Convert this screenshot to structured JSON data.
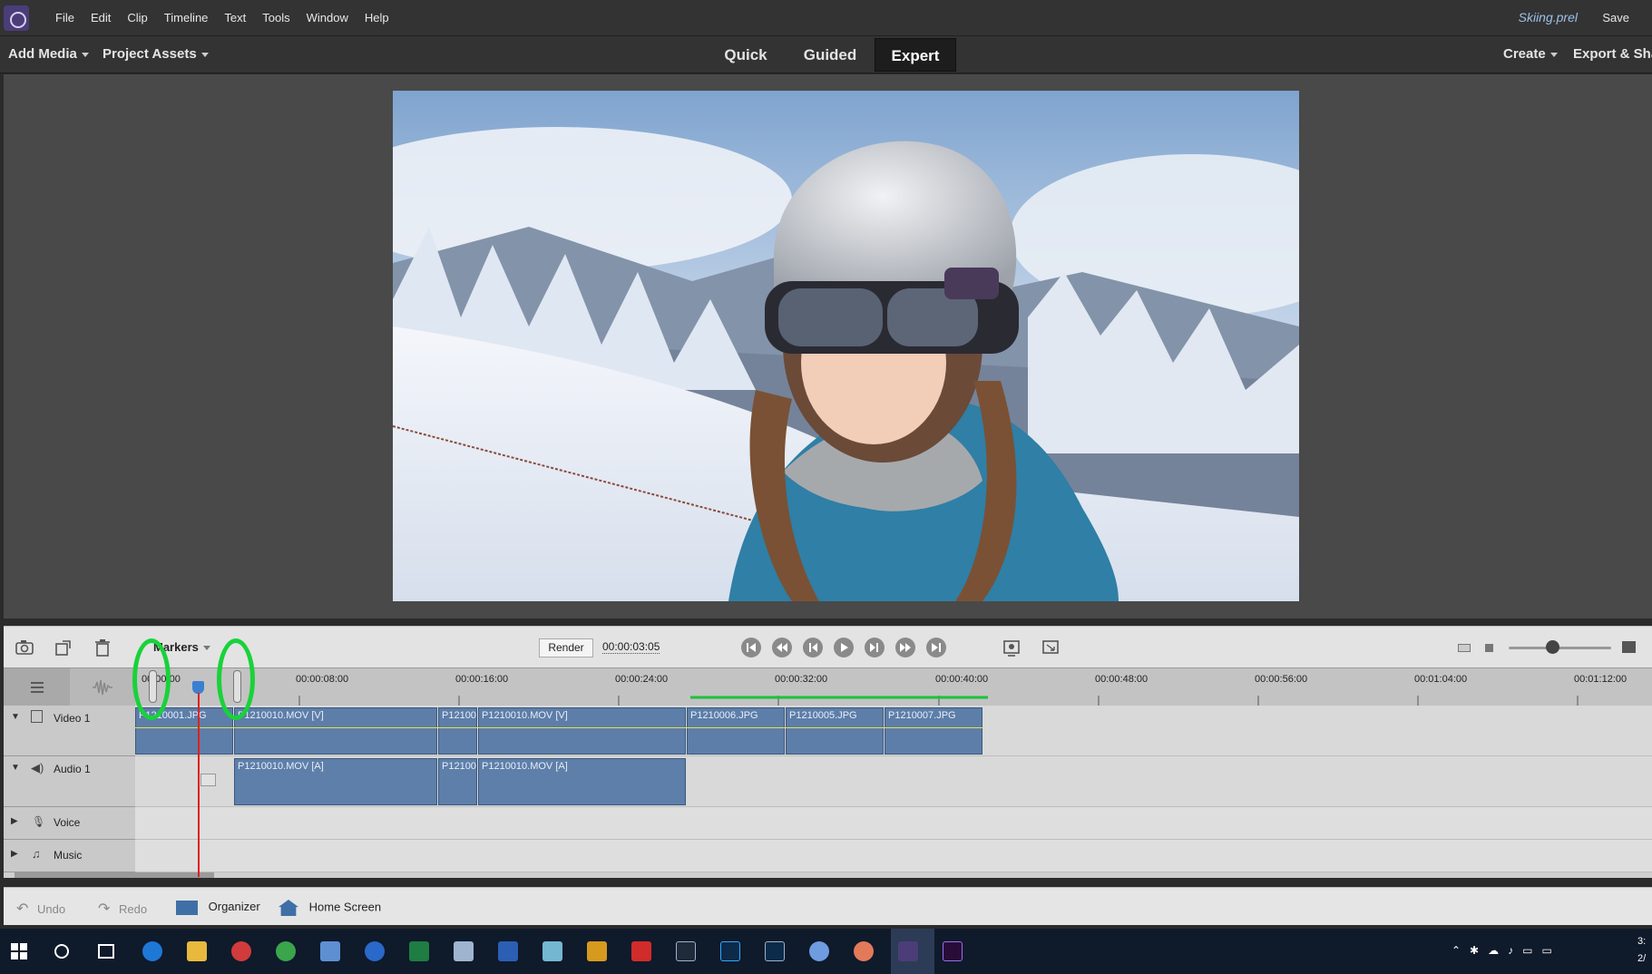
{
  "menubar": {
    "items": [
      "File",
      "Edit",
      "Clip",
      "Timeline",
      "Text",
      "Tools",
      "Window",
      "Help"
    ],
    "project_name": "Skiing.prel",
    "save_label": "Save"
  },
  "modebar": {
    "add_media": "Add Media",
    "project_assets": "Project Assets",
    "tabs": [
      "Quick",
      "Guided",
      "Expert"
    ],
    "active_tab": "Expert",
    "create": "Create",
    "export": "Export & Sha"
  },
  "transport": {
    "markers_label": "Markers",
    "render_label": "Render",
    "timecode": "00:00:03:05"
  },
  "ruler": {
    "start_time": "00:00:00",
    "ticks": [
      "00:00:08:00",
      "00:00:16:00",
      "00:00:24:00",
      "00:00:32:00",
      "00:00:40:00",
      "00:00:48:00",
      "00:00:56:00",
      "00:01:04:00",
      "00:01:12:00"
    ]
  },
  "tracks": {
    "video1": "Video 1",
    "audio1": "Audio 1",
    "voice": "Voice",
    "music": "Music",
    "video_clips": [
      "P1210001.JPG",
      "P1210010.MOV [V]",
      "P12100",
      "P1210010.MOV [V]",
      "P1210006.JPG",
      "P1210005.JPG",
      "P1210007.JPG"
    ],
    "audio_clips": [
      "P1210010.MOV [A]",
      "P12100",
      "P1210010.MOV [A]"
    ]
  },
  "bottombar": {
    "undo": "Undo",
    "redo": "Redo",
    "organizer": "Organizer",
    "home_screen": "Home Screen"
  },
  "taskbar": {
    "clock": "3:",
    "date": "2/"
  },
  "colors": {
    "accent_purple": "#4b3d78",
    "clip_blue": "#5d7ea8",
    "playhead_red": "#e02020",
    "highlight_green": "#19d23a"
  }
}
